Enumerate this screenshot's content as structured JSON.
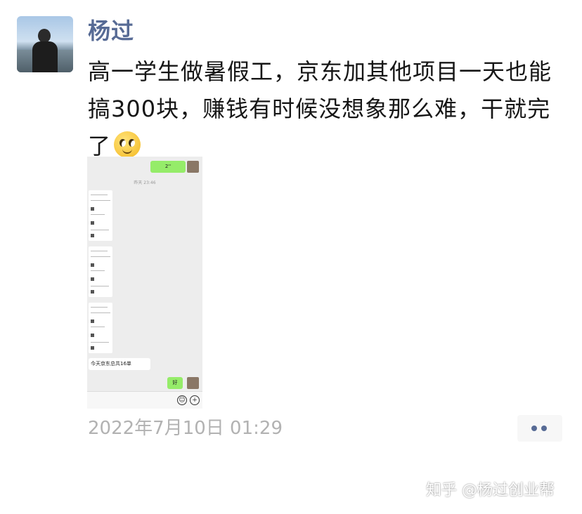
{
  "post": {
    "author": "杨过",
    "text": "高一学生做暑假工，京东加其他项目一天也能搞300块，赚钱有时候没想象那么难，干就完了",
    "emoji": "smile-emoji",
    "timestamp": "2022年7月10日 01:29"
  },
  "screenshot": {
    "voice_msg": "2''",
    "time_label": "昨天 23:46",
    "summary_msg": "今天京东总共16单",
    "reply_msg": "好"
  },
  "watermark": "知乎 @杨过创业帮",
  "colors": {
    "name": "#576b95",
    "text": "#161616",
    "timestamp": "#b2b2b2",
    "bubble_green": "#95ec69"
  }
}
